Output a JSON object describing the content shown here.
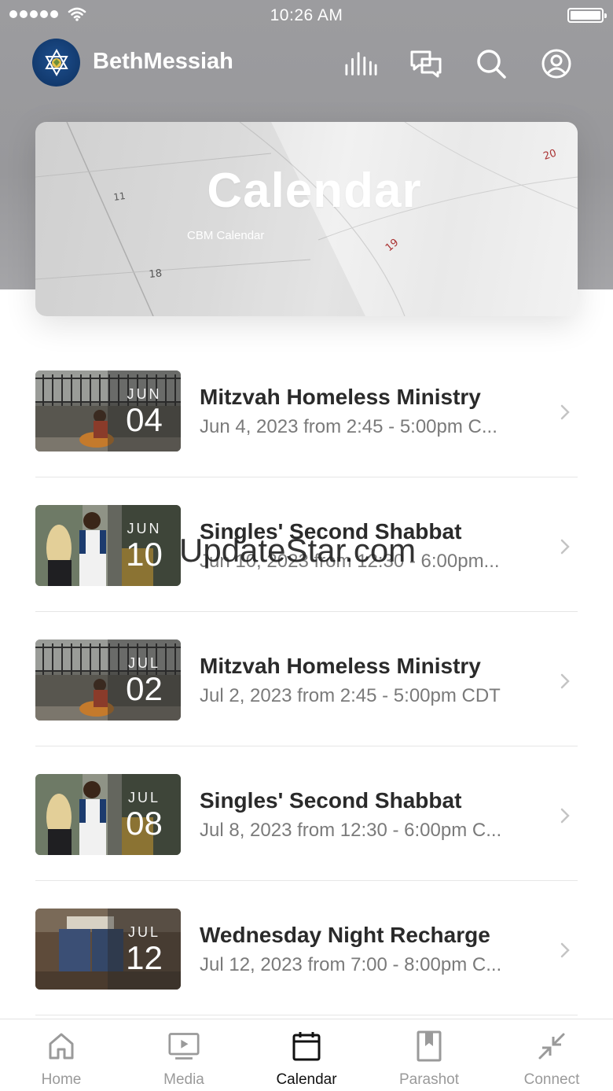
{
  "status_bar": {
    "time": "10:26 AM"
  },
  "header": {
    "app_name": "BethMessiah"
  },
  "banner": {
    "title": "Calendar",
    "subtitle": "CBM Calendar"
  },
  "events": [
    {
      "month": "JUN",
      "day": "04",
      "title": "Mitzvah Homeless Ministry",
      "subtitle": "Jun 4, 2023 from 2:45 - 5:00pm C..."
    },
    {
      "month": "JUN",
      "day": "10",
      "title": "Singles' Second Shabbat",
      "subtitle": "Jun 10, 2023 from 12:30 - 6:00pm..."
    },
    {
      "month": "JUL",
      "day": "02",
      "title": "Mitzvah Homeless Ministry",
      "subtitle": "Jul 2, 2023 from 2:45 - 5:00pm CDT"
    },
    {
      "month": "JUL",
      "day": "08",
      "title": "Singles' Second Shabbat",
      "subtitle": "Jul 8, 2023 from 12:30 - 6:00pm C..."
    },
    {
      "month": "JUL",
      "day": "12",
      "title": "Wednesday Night Recharge",
      "subtitle": "Jul 12, 2023 from 7:00 - 8:00pm C..."
    }
  ],
  "watermark": "UpdateStar.com",
  "tabs": [
    {
      "label": "Home",
      "icon": "home-icon",
      "active": false
    },
    {
      "label": "Media",
      "icon": "play-screen-icon",
      "active": false
    },
    {
      "label": "Calendar",
      "icon": "calendar-icon",
      "active": true
    },
    {
      "label": "Parashot",
      "icon": "bookmark-book-icon",
      "active": false
    },
    {
      "label": "Connect",
      "icon": "arrows-in-icon",
      "active": false
    }
  ],
  "colors": {
    "header_bg": "#9a9a9d",
    "logo_bg": "#143d73",
    "active_tab": "#111111",
    "inactive_tab": "#9a9a9a"
  }
}
